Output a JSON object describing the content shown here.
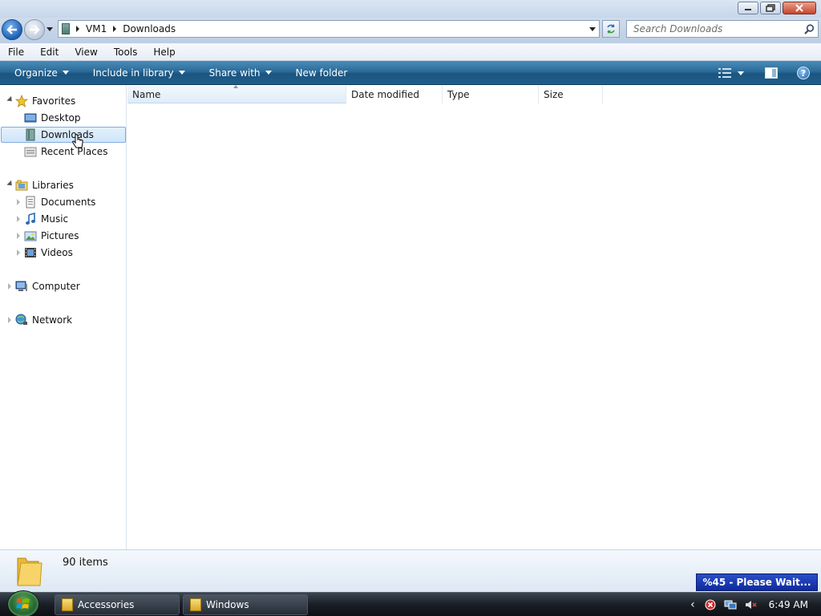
{
  "address": {
    "crumbs": [
      "VM1",
      "Downloads"
    ]
  },
  "search": {
    "placeholder": "Search Downloads"
  },
  "menu": [
    "File",
    "Edit",
    "View",
    "Tools",
    "Help"
  ],
  "commands": {
    "organize": "Organize",
    "include": "Include in library",
    "share": "Share with",
    "newfolder": "New folder"
  },
  "nav": {
    "favorites": "Favorites",
    "desktop": "Desktop",
    "downloads": "Downloads",
    "recent": "Recent Places",
    "libraries": "Libraries",
    "documents": "Documents",
    "music": "Music",
    "pictures": "Pictures",
    "videos": "Videos",
    "computer": "Computer",
    "network": "Network"
  },
  "columns": [
    "Name",
    "Date modified",
    "Type",
    "Size"
  ],
  "details": {
    "count": "90 items"
  },
  "overlay": {
    "wait": "%45 - Please Wait..."
  },
  "taskbar": {
    "tasks": [
      "Accessories",
      "Windows"
    ],
    "clock": "6:49 AM"
  },
  "colors": {
    "command_bar": "#1f5f8a",
    "wait_badge": "#0f2a9c"
  }
}
